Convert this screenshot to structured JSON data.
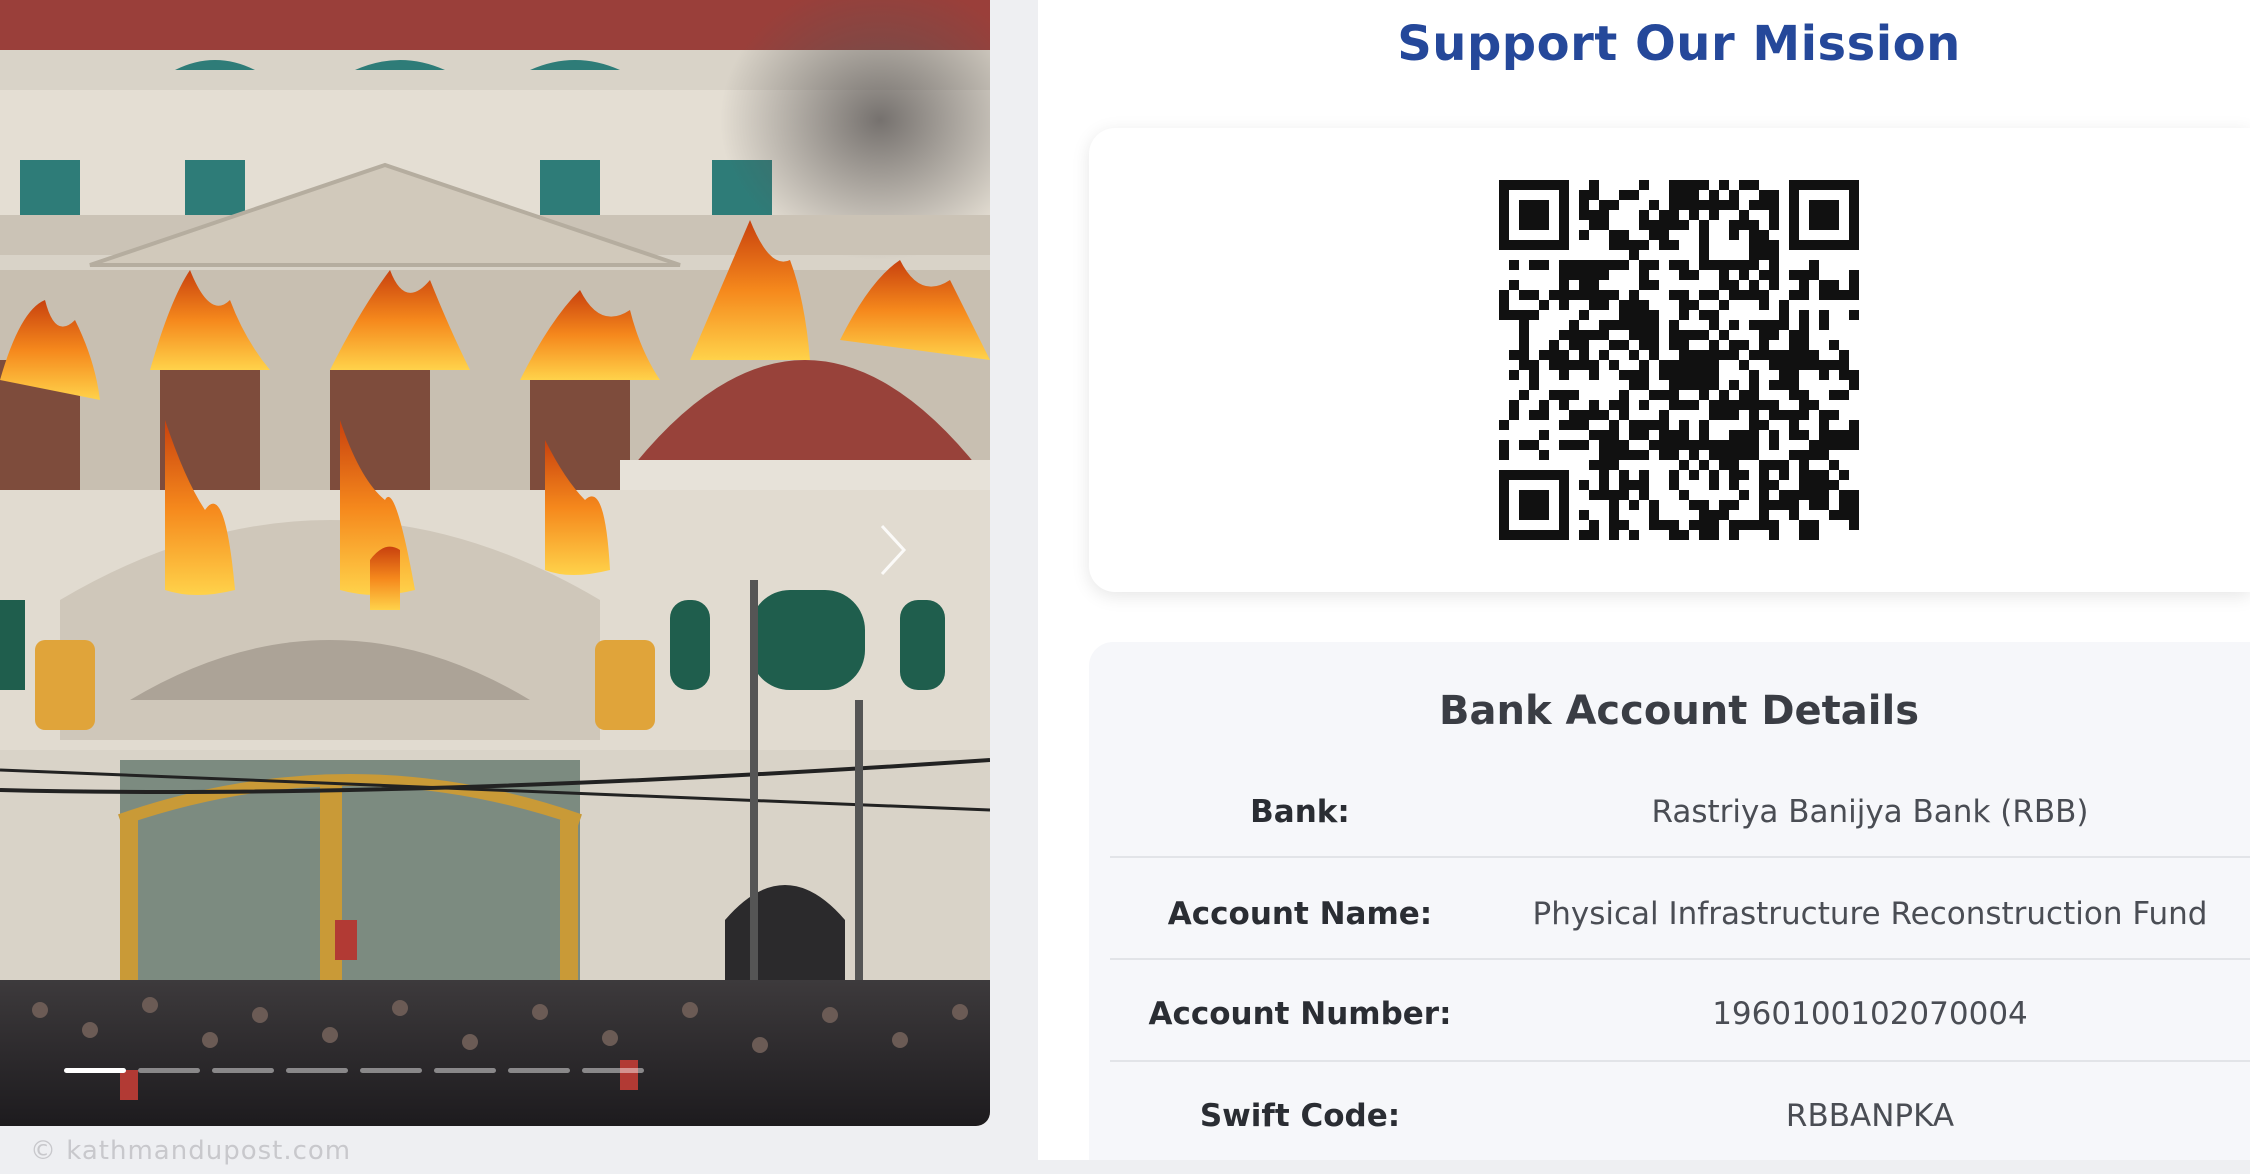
{
  "carousel": {
    "slide_count": 8,
    "active_slide": 1,
    "next_icon": "chevron-right-icon",
    "caption": "© kathmandupost.com"
  },
  "mission": {
    "title": "Support Our Mission",
    "qr_icon": "qr-code-icon"
  },
  "bank": {
    "title": "Bank Account Details",
    "rows": [
      {
        "label": "Bank:",
        "value": "Rastriya Banijya Bank (RBB)"
      },
      {
        "label": "Account Name:",
        "value": "Physical Infrastructure Reconstruction Fund"
      },
      {
        "label": "Account Number:",
        "value": "1960100102070004"
      },
      {
        "label": "Swift Code:",
        "value": "RBBANPKA"
      }
    ]
  },
  "colors": {
    "accent": "#25489a",
    "fire": "#f08a1c",
    "panel_bg": "#f6f7fa"
  }
}
